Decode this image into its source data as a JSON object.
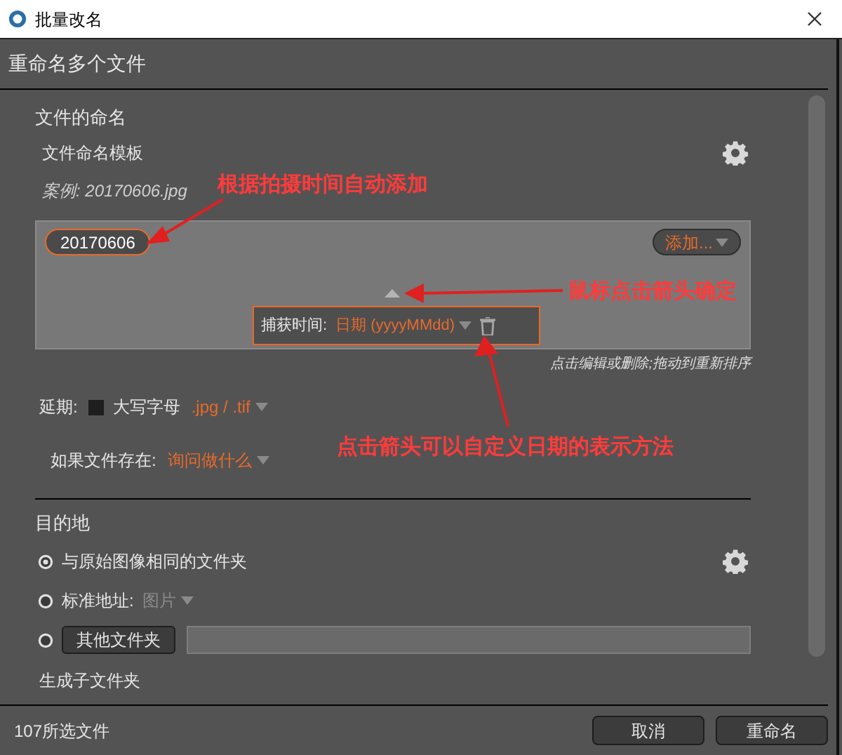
{
  "window": {
    "title": "批量改名"
  },
  "header": "重命名多个文件",
  "naming": {
    "title": "文件的命名",
    "template_label": "文件命名模板",
    "example": "案例: 20170606.jpg",
    "tokens": [
      {
        "text": "20170606",
        "selected": true
      }
    ],
    "add_button": "添加...",
    "token_editor": {
      "label": "捕获时间:",
      "value": "日期 (yyyyMMdd)"
    },
    "hint": "点击编辑或删除;拖动到重新排序"
  },
  "extension": {
    "label": "延期:",
    "uppercase_label": "大写字母",
    "uppercase_checked": false,
    "value": ".jpg / .tif"
  },
  "if_exists": {
    "label": "如果文件存在:",
    "value": "询问做什么"
  },
  "destination": {
    "title": "目的地",
    "options": [
      {
        "kind": "label",
        "text": "与原始图像相同的文件夹",
        "selected": true
      },
      {
        "kind": "dropdown",
        "text": "标准地址:",
        "value": "图片",
        "selected": false
      },
      {
        "kind": "folder",
        "button": "其他文件夹",
        "selected": false
      }
    ],
    "subfolder_label": "生成子文件夹"
  },
  "footer": {
    "count": "107所选文件",
    "buttons": [
      "取消",
      "重命名"
    ]
  },
  "annotations": [
    {
      "text": "根据拍摄时间自动添加"
    },
    {
      "text": "鼠标点击箭头确定"
    },
    {
      "text": "点击箭头可以自定义日期的表示方法"
    }
  ]
}
